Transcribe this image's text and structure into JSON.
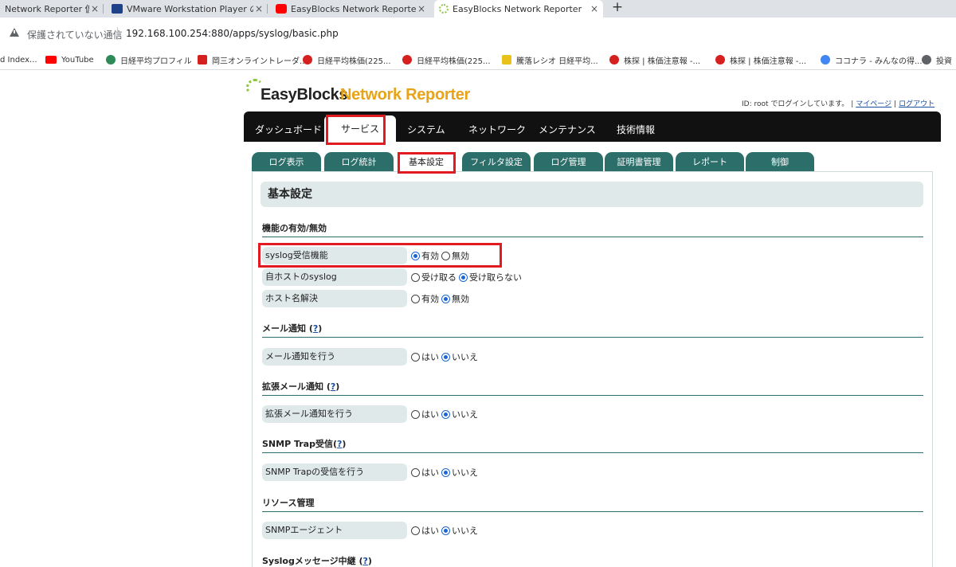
{
  "browser": {
    "tabs": [
      {
        "label": "Network Reporter 仮",
        "icon_color": "#4a90d9",
        "active": false
      },
      {
        "label": "VMware Workstation Player のダ",
        "icon_color": "#1d428a",
        "active": false
      },
      {
        "label": "EasyBlocks Network Reporter 仮",
        "icon_color": "#ff0000",
        "active": false
      },
      {
        "label": "EasyBlocks Network Reporter",
        "icon_color": "#8cc63f",
        "active": true
      }
    ],
    "close_glyph": "×",
    "new_tab_glyph": "+",
    "insecure_text": "保護されていない通信",
    "url": "192.168.100.254:880/apps/syslog/basic.php",
    "bookmarks": [
      {
        "label": "d Index...",
        "icon_color": ""
      },
      {
        "label": "YouTube",
        "icon_color": "#ff0000"
      },
      {
        "label": "日経平均プロフィル",
        "icon_color": "#2e8b57"
      },
      {
        "label": "岡三オンライントレーダ...",
        "icon_color": "#d62020"
      },
      {
        "label": "日経平均株価(225...",
        "icon_color": "#d62020"
      },
      {
        "label": "日経平均株価(225...",
        "icon_color": "#d62020"
      },
      {
        "label": "騰落レシオ 日経平均...",
        "icon_color": "#e8c21a"
      },
      {
        "label": "株探 | 株価注意報 -...",
        "icon_color": "#d62020"
      },
      {
        "label": "株探 | 株価注意報 -...",
        "icon_color": "#d62020"
      },
      {
        "label": "ココナラ - みんなの得...",
        "icon_color": "#4285f4"
      },
      {
        "label": "投資",
        "icon_color": "#5f6368"
      }
    ]
  },
  "app": {
    "brand": "EasyBlocks",
    "product": "Network Reporter",
    "login_text": "ID: root でログインしています。",
    "mypage": "マイページ",
    "logout": "ログアウト",
    "nav": [
      {
        "label": "ダッシュボード",
        "active": false
      },
      {
        "label": "サービス",
        "active": true
      },
      {
        "label": "システム",
        "active": false
      },
      {
        "label": "ネットワーク",
        "active": false
      },
      {
        "label": "メンテナンス",
        "active": false
      },
      {
        "label": "技術情報",
        "active": false
      }
    ],
    "subtabs": [
      {
        "label": "ログ表示",
        "active": false
      },
      {
        "label": "ログ統計",
        "active": false
      },
      {
        "label": "基本設定",
        "active": true
      },
      {
        "label": "フィルタ設定",
        "active": false
      },
      {
        "label": "ログ管理",
        "active": false
      },
      {
        "label": "証明書管理",
        "active": false
      },
      {
        "label": "レポート",
        "active": false
      },
      {
        "label": "制御",
        "active": false
      }
    ],
    "page_title": "基本設定",
    "help_text": "?",
    "sections": [
      {
        "title": "機能の有効/無効",
        "help": false,
        "rows": [
          {
            "label": "syslog受信機能",
            "options": [
              "有効",
              "無効"
            ],
            "selected": 0
          },
          {
            "label": "自ホストのsyslog",
            "options": [
              "受け取る",
              "受け取らない"
            ],
            "selected": 1
          },
          {
            "label": "ホスト名解決",
            "options": [
              "有効",
              "無効"
            ],
            "selected": 1
          }
        ]
      },
      {
        "title": "メール通知",
        "help": true,
        "rows": [
          {
            "label": "メール通知を行う",
            "options": [
              "はい",
              "いいえ"
            ],
            "selected": 1
          }
        ]
      },
      {
        "title": "拡張メール通知",
        "help": true,
        "rows": [
          {
            "label": "拡張メール通知を行う",
            "options": [
              "はい",
              "いいえ"
            ],
            "selected": 1
          }
        ]
      },
      {
        "title": "SNMP Trap受信",
        "help": true,
        "rows": [
          {
            "label": "SNMP Trapの受信を行う",
            "options": [
              "はい",
              "いいえ"
            ],
            "selected": 1
          }
        ]
      },
      {
        "title": "リソース管理",
        "help": false,
        "rows": [
          {
            "label": "SNMPエージェント",
            "options": [
              "はい",
              "いいえ"
            ],
            "selected": 1
          }
        ]
      },
      {
        "title": "Syslogメッセージ中継",
        "help": true,
        "rows": []
      }
    ],
    "highlight_color": "#e21a22"
  }
}
